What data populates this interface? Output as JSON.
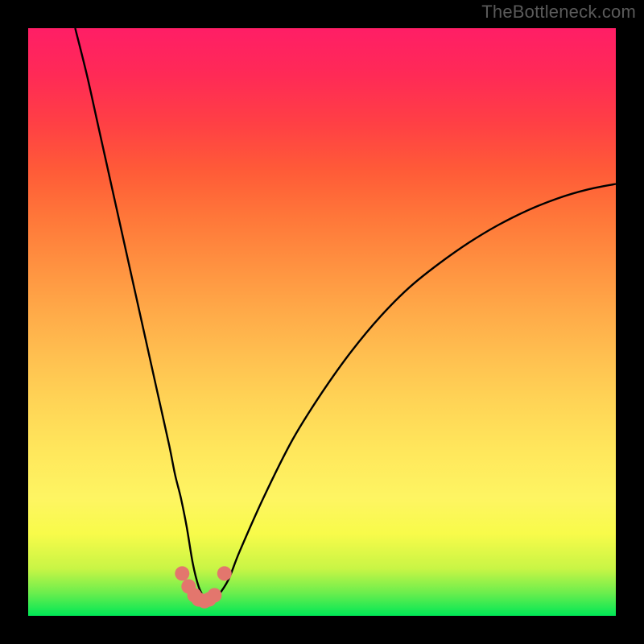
{
  "attribution": "TheBottleneck.com",
  "chart_data": {
    "type": "line",
    "title": "",
    "xlabel": "",
    "ylabel": "",
    "xlim": [
      0,
      100
    ],
    "ylim": [
      0,
      100
    ],
    "series": [
      {
        "name": "bottleneck-curve",
        "x": [
          8,
          10,
          12,
          14,
          16,
          18,
          20,
          22,
          24,
          25,
          26,
          27,
          28,
          29,
          30,
          31,
          32,
          34,
          36,
          40,
          45,
          50,
          55,
          60,
          65,
          70,
          75,
          80,
          85,
          90,
          95,
          100
        ],
        "y": [
          100,
          92,
          83,
          74,
          65,
          56,
          47,
          38,
          29,
          24,
          20,
          15,
          9,
          5,
          3,
          2,
          3,
          6,
          11,
          20,
          30,
          38,
          45,
          51,
          56,
          60,
          63.5,
          66.5,
          69,
          71,
          72.5,
          73.5
        ]
      }
    ],
    "markers": {
      "name": "optimum-points",
      "color": "#e3766d",
      "x": [
        26.2,
        27.3,
        28.3,
        29.0,
        30.0,
        30.8,
        31.7,
        33.4
      ],
      "y": [
        7.2,
        5.0,
        3.5,
        2.8,
        2.5,
        2.8,
        3.5,
        7.2
      ]
    },
    "gradient_stops": [
      {
        "pos": 0,
        "color": "#00e756"
      },
      {
        "pos": 14,
        "color": "#f8fb4a"
      },
      {
        "pos": 52,
        "color": "#ffa948"
      },
      {
        "pos": 84,
        "color": "#ff3f45"
      },
      {
        "pos": 100,
        "color": "#ff1e66"
      }
    ]
  }
}
